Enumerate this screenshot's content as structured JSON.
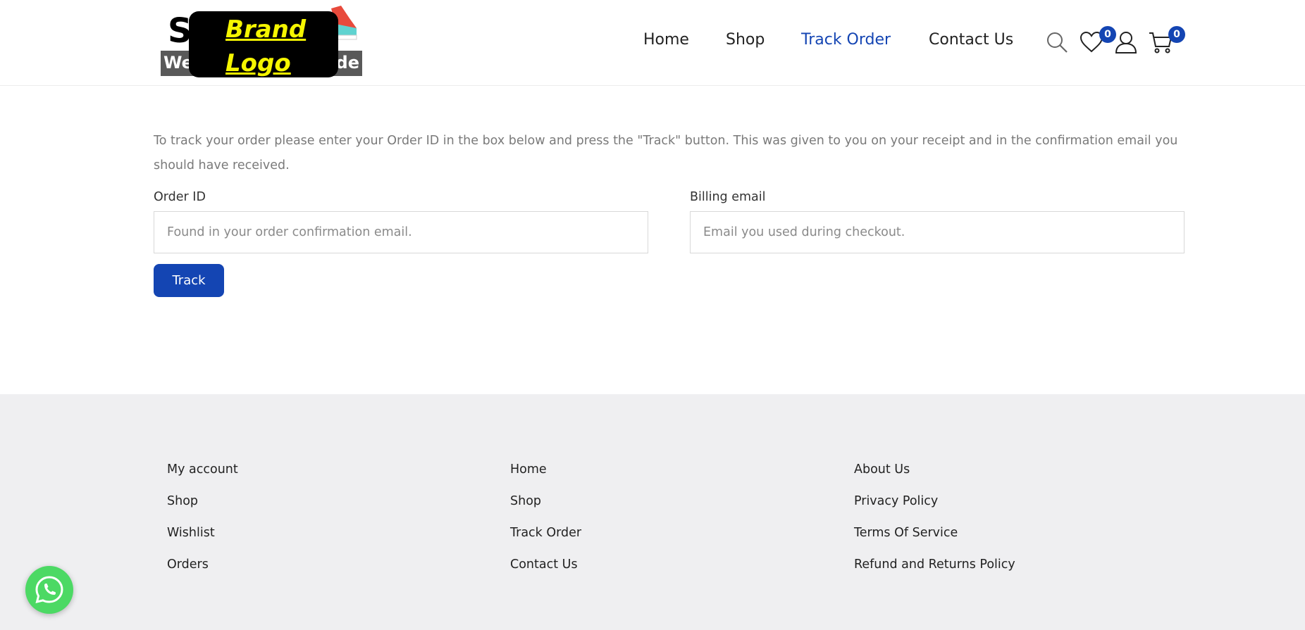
{
  "header": {
    "logo": {
      "left_fragment": "We",
      "right_fragment": "ide",
      "top_letter": "S",
      "overlay_line1": "Brand",
      "overlay_line2": "Logo"
    },
    "nav": [
      {
        "label": "Home",
        "active": false
      },
      {
        "label": "Shop",
        "active": false
      },
      {
        "label": "Track Order",
        "active": true
      },
      {
        "label": "Contact Us",
        "active": false
      }
    ],
    "icons": {
      "search": "search-icon",
      "wishlist": "heart-icon",
      "account": "user-icon",
      "cart": "cart-icon"
    },
    "wishlist_count": "0",
    "cart_count": "0",
    "accent_color": "#1445b3"
  },
  "main": {
    "intro": "To track your order please enter your Order ID in the box below and press the \"Track\" button. This was given to you on your receipt and in the confirmation email you should have received.",
    "order_id_label": "Order ID",
    "order_id_placeholder": "Found in your order confirmation email.",
    "email_label": "Billing email",
    "email_placeholder": "Email you used during checkout.",
    "track_button": "Track"
  },
  "footer": {
    "col1": [
      "My account",
      "Shop",
      "Wishlist",
      "Orders"
    ],
    "col2": [
      "Home",
      "Shop",
      "Track Order",
      "Contact Us"
    ],
    "col3": [
      "About Us",
      "Privacy Policy",
      "Terms Of Service",
      "Refund and Returns Policy"
    ],
    "whatsapp_icon": "whatsapp-icon"
  }
}
